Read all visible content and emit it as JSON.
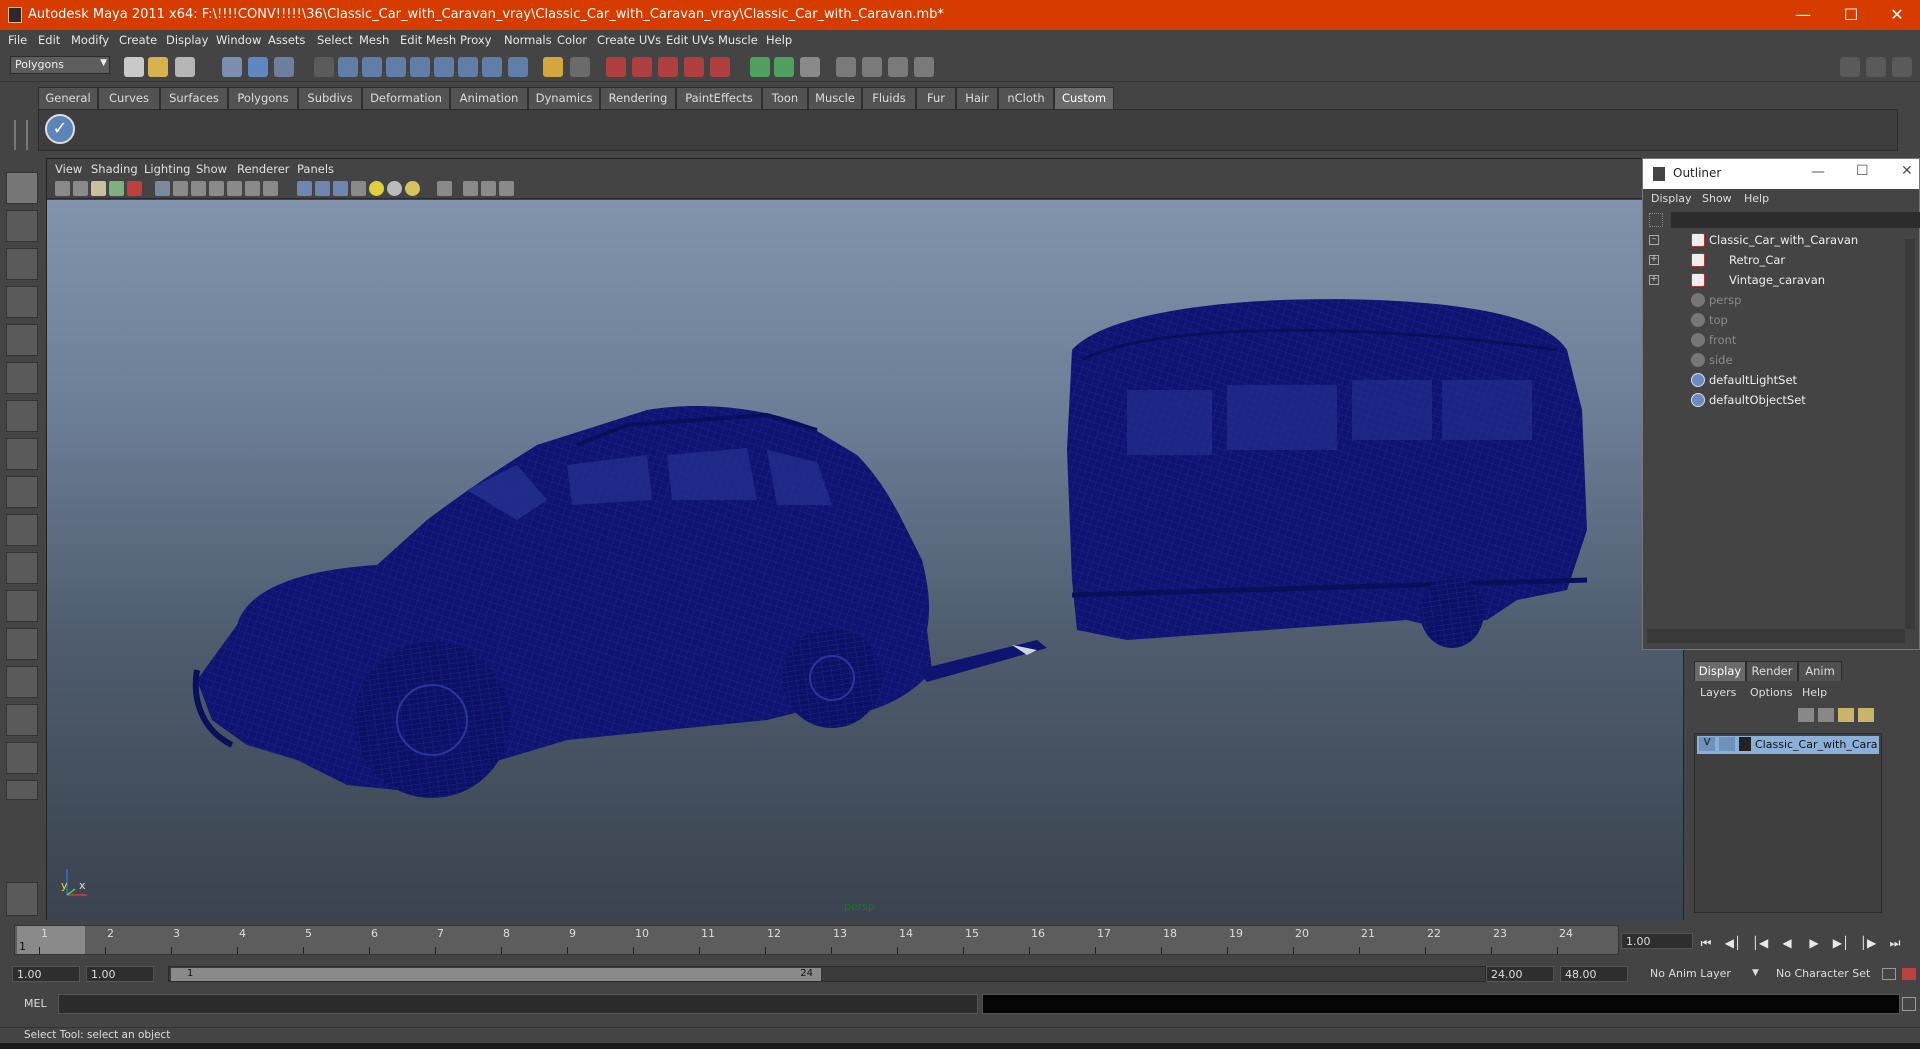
{
  "window": {
    "title": "Autodesk Maya 2011 x64: F:\\!!!!CONV!!!!!\\36\\Classic_Car_with_Caravan_vray\\Classic_Car_with_Caravan_vray\\Classic_Car_with_Caravan.mb*",
    "controls": [
      "minimize-icon",
      "maximize-icon",
      "close-icon"
    ]
  },
  "menubar": [
    "File",
    "Edit",
    "Modify",
    "Create",
    "Display",
    "Window",
    "Assets",
    "Select",
    "Mesh",
    "Edit Mesh",
    "Proxy",
    "Normals",
    "Color",
    "Create UVs",
    "Edit UVs",
    "Muscle",
    "Help"
  ],
  "toolbar": {
    "mode": "Polygons"
  },
  "shelf": {
    "tabs": [
      "General",
      "Curves",
      "Surfaces",
      "Polygons",
      "Subdivs",
      "Deformation",
      "Animation",
      "Dynamics",
      "Rendering",
      "PaintEffects",
      "Toon",
      "Muscle",
      "Fluids",
      "Fur",
      "Hair",
      "nCloth",
      "Custom"
    ],
    "active_tab": "Custom"
  },
  "viewport": {
    "menu": [
      "View",
      "Shading",
      "Lighting",
      "Show",
      "Renderer",
      "Panels"
    ],
    "camera_label": "persp",
    "axis": {
      "y": "y",
      "x": "x"
    },
    "wireframe_color": "#0f1470"
  },
  "outliner": {
    "title": "Outliner",
    "menu": [
      "Display",
      "Show",
      "Help"
    ],
    "items": [
      {
        "label": "Classic_Car_with_Caravan",
        "dim": false,
        "icon": "transform-icon"
      },
      {
        "label": "Retro_Car",
        "dim": false,
        "icon": "transform-icon"
      },
      {
        "label": "Vintage_caravan",
        "dim": false,
        "icon": "transform-icon"
      },
      {
        "label": "persp",
        "dim": true,
        "icon": "camera-icon"
      },
      {
        "label": "top",
        "dim": true,
        "icon": "camera-icon"
      },
      {
        "label": "front",
        "dim": true,
        "icon": "camera-icon"
      },
      {
        "label": "side",
        "dim": true,
        "icon": "camera-icon"
      },
      {
        "label": "defaultLightSet",
        "dim": false,
        "icon": "set-icon"
      },
      {
        "label": "defaultObjectSet",
        "dim": false,
        "icon": "set-icon"
      }
    ]
  },
  "layer_editor": {
    "tabs": [
      "Display",
      "Render",
      "Anim"
    ],
    "active_tab": "Display",
    "menu": [
      "Layers",
      "Options",
      "Help"
    ],
    "layer": {
      "visibility": "V",
      "name": "Classic_Car_with_Carava"
    }
  },
  "timeline": {
    "ticks": [
      "1",
      "2",
      "3",
      "4",
      "5",
      "6",
      "7",
      "8",
      "9",
      "10",
      "11",
      "12",
      "13",
      "14",
      "15",
      "16",
      "17",
      "18",
      "19",
      "20",
      "21",
      "22",
      "23",
      "24"
    ],
    "current_frame": "1",
    "current_frame_field": "1.00"
  },
  "range": {
    "start": "1.00",
    "playback_start": "1.00",
    "slider_start": "1",
    "slider_end": "24",
    "playback_end": "24.00",
    "end": "48.00",
    "anim_layer": "No Anim Layer",
    "character_set": "No Character Set"
  },
  "command_line": {
    "label": "MEL"
  },
  "help_line": "Select Tool: select an object"
}
